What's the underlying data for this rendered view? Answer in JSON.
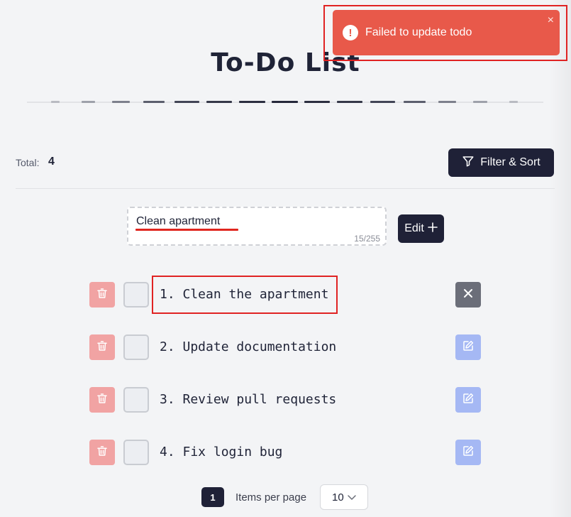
{
  "page": {
    "title": "To-Do List"
  },
  "summary": {
    "total_label": "Total:",
    "total_value": "4"
  },
  "toolbar": {
    "filter_sort_label": "Filter & Sort"
  },
  "editor": {
    "input_value": "Clean apartment",
    "char_count": "15/255",
    "edit_label": "Edit"
  },
  "todos": [
    {
      "text": "1. Clean the apartment",
      "action": "cancel"
    },
    {
      "text": "2. Update documentation",
      "action": "edit"
    },
    {
      "text": "3. Review pull requests",
      "action": "edit"
    },
    {
      "text": "4. Fix login bug",
      "action": "edit"
    }
  ],
  "pagination": {
    "current_page": "1",
    "items_per_page_label": "Items per page",
    "items_per_page_value": "10"
  },
  "toast": {
    "message": "Failed to update todo",
    "close_symbol": "×"
  },
  "colors": {
    "primary_dark": "#1f2137",
    "delete": "#f1a3a3",
    "edit": "#a5b8f4",
    "cancel": "#6b6e79",
    "toast_error": "#e8594a",
    "highlight": "#e02323"
  },
  "icons": {
    "filter": "funnel-icon",
    "edit_add": "plus-icon",
    "delete": "trash-icon",
    "edit": "pencil-icon",
    "cancel": "close-icon",
    "toast": "error-icon",
    "select": "chevron-down-icon"
  }
}
